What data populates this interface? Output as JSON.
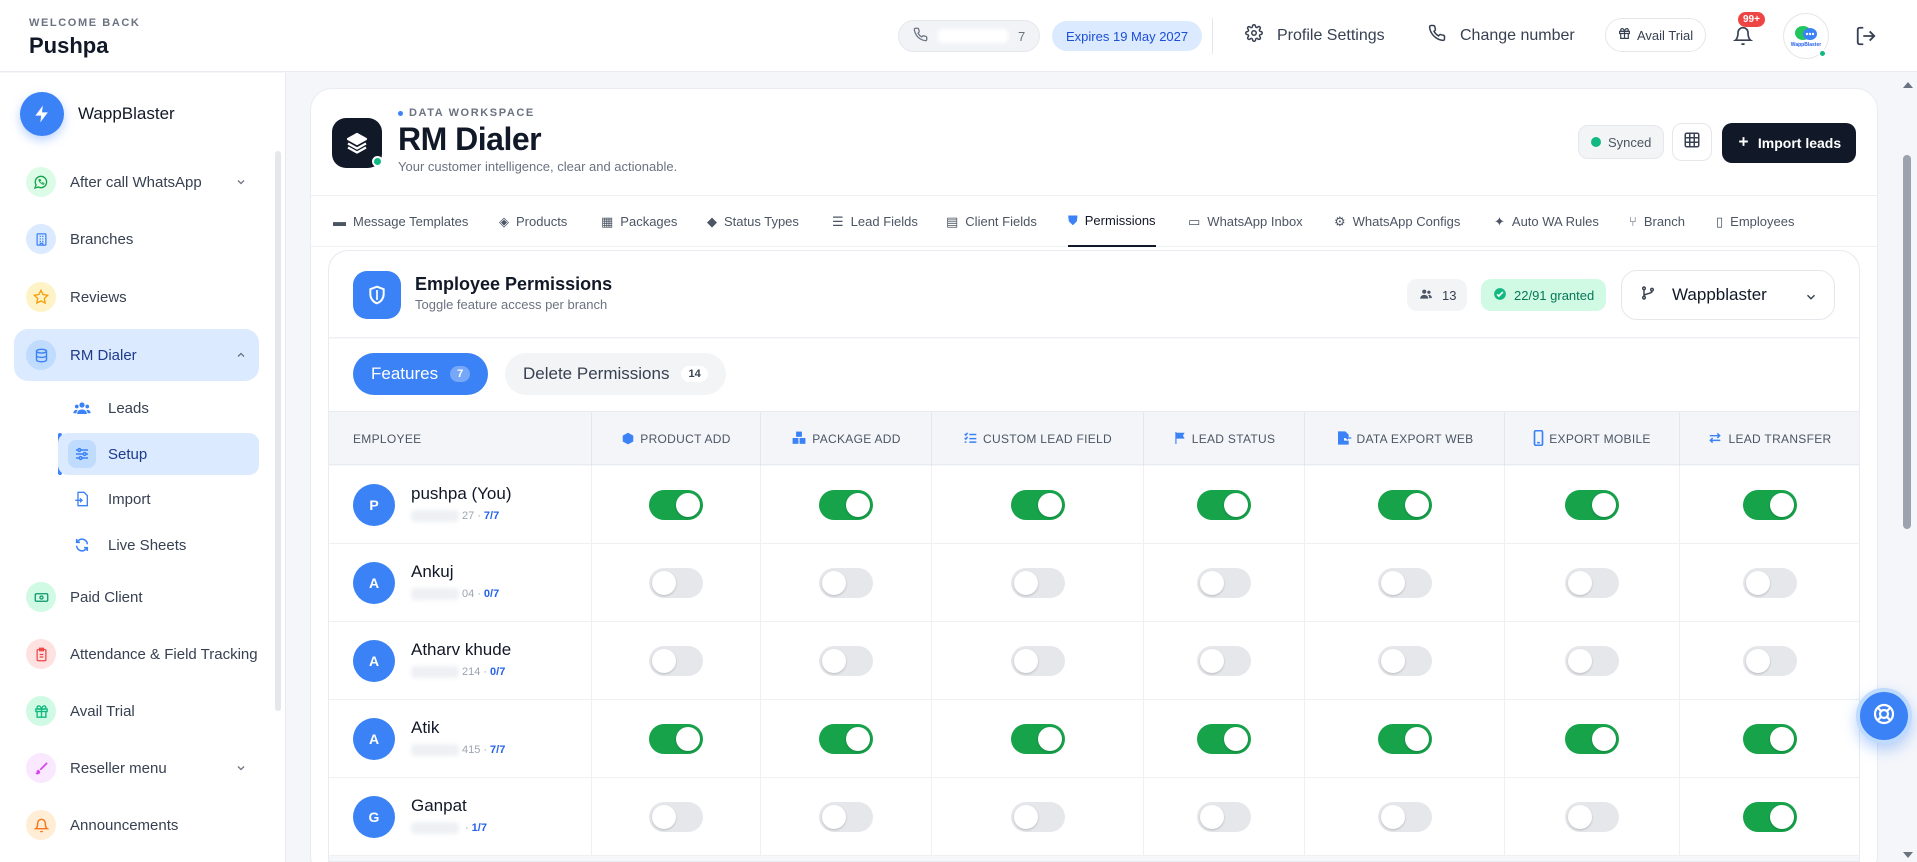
{
  "header": {
    "welcome_label": "WELCOME BACK",
    "username": "Pushpa",
    "phone_suffix": "7",
    "expires_label": "Expires 19 May 2027",
    "profile_settings_label": "Profile Settings",
    "change_number_label": "Change number",
    "avail_trial_label": "Avail Trial",
    "notification_badge": "99+",
    "avatar_text": "WappBlaster"
  },
  "sidebar": {
    "brand": "WappBlaster",
    "items": [
      {
        "label": "After call WhatsApp",
        "icon": "whatsapp-icon",
        "color": "#16a34a",
        "bg": "#dcfce7"
      },
      {
        "label": "Branches",
        "icon": "building-icon",
        "color": "#3b82f6",
        "bg": "#dbeafe"
      },
      {
        "label": "Reviews",
        "icon": "star-icon",
        "color": "#f59e0b",
        "bg": "#fef3c7"
      },
      {
        "label": "RM Dialer",
        "icon": "database-icon",
        "color": "#3b82f6",
        "bg": "#bfdbfe"
      },
      {
        "label": "Paid Client",
        "icon": "cash-icon",
        "color": "#059669",
        "bg": "#d1fae5"
      },
      {
        "label": "Attendance & Field Tracking",
        "icon": "clipboard-icon",
        "color": "#ef4444",
        "bg": "#fee2e2"
      },
      {
        "label": "Avail Trial",
        "icon": "gift-icon",
        "color": "#10b981",
        "bg": "#d1fae5"
      },
      {
        "label": "Reseller menu",
        "icon": "brush-icon",
        "color": "#d946ef",
        "bg": "#fae8ff"
      },
      {
        "label": "Announcements",
        "icon": "bell-icon",
        "color": "#f97316",
        "bg": "#ffedd5"
      }
    ],
    "subitems": [
      {
        "label": "Leads",
        "icon": "users-icon"
      },
      {
        "label": "Setup",
        "icon": "sliders-icon"
      },
      {
        "label": "Import",
        "icon": "file-import-icon"
      },
      {
        "label": "Live Sheets",
        "icon": "sync-icon"
      }
    ]
  },
  "workspace": {
    "label": "DATA WORKSPACE",
    "title": "RM Dialer",
    "subtitle": "Your customer intelligence, clear and actionable.",
    "synced_label": "Synced",
    "import_label": "Import leads"
  },
  "tabs": [
    {
      "label": "Message Templates",
      "icon": "message-icon"
    },
    {
      "label": "Products",
      "icon": "tag-icon"
    },
    {
      "label": "Packages",
      "icon": "boxes-icon"
    },
    {
      "label": "Status Types",
      "icon": "label-icon"
    },
    {
      "label": "Lead Fields",
      "icon": "list-icon"
    },
    {
      "label": "Client Fields",
      "icon": "table-icon"
    },
    {
      "label": "Permissions",
      "icon": "shield-icon"
    },
    {
      "label": "WhatsApp Inbox",
      "icon": "inbox-icon"
    },
    {
      "label": "WhatsApp Configs",
      "icon": "gear-icon"
    },
    {
      "label": "Auto WA Rules",
      "icon": "magic-icon"
    },
    {
      "label": "Branch",
      "icon": "branch-icon"
    },
    {
      "label": "Employees",
      "icon": "id-card-icon"
    }
  ],
  "permissions": {
    "title": "Employee Permissions",
    "subtitle": "Toggle feature access per branch",
    "employee_count": "13",
    "granted_label": "22/91 granted",
    "branch": "Wappblaster",
    "feature_tab": {
      "label": "Features",
      "count": "7"
    },
    "delete_tab": {
      "label": "Delete Permissions",
      "count": "14"
    },
    "columns": [
      {
        "label": "EMPLOYEE",
        "icon": ""
      },
      {
        "label": "PRODUCT ADD",
        "icon": "box-icon"
      },
      {
        "label": "PACKAGE ADD",
        "icon": "boxes-icon"
      },
      {
        "label": "CUSTOM LEAD FIELD",
        "icon": "list-check-icon"
      },
      {
        "label": "LEAD STATUS",
        "icon": "flag-icon"
      },
      {
        "label": "DATA EXPORT WEB",
        "icon": "file-export-icon"
      },
      {
        "label": "EXPORT MOBILE",
        "icon": "mobile-icon"
      },
      {
        "label": "LEAD TRANSFER",
        "icon": "transfer-icon"
      }
    ],
    "rows": [
      {
        "initial": "P",
        "name": "pushpa (You)",
        "phone_tail": "27",
        "score": "7/7",
        "perms": [
          true,
          true,
          true,
          true,
          true,
          true,
          true
        ]
      },
      {
        "initial": "A",
        "name": "Ankuj",
        "phone_tail": "04",
        "score": "0/7",
        "perms": [
          false,
          false,
          false,
          false,
          false,
          false,
          false
        ]
      },
      {
        "initial": "A",
        "name": "Atharv khude",
        "phone_tail": "214",
        "score": "0/7",
        "perms": [
          false,
          false,
          false,
          false,
          false,
          false,
          false
        ]
      },
      {
        "initial": "A",
        "name": "Atik",
        "phone_tail": "415",
        "score": "7/7",
        "perms": [
          true,
          true,
          true,
          true,
          true,
          true,
          true
        ]
      },
      {
        "initial": "G",
        "name": "Ganpat",
        "phone_tail": "",
        "score": "1/7",
        "perms": [
          false,
          false,
          false,
          false,
          false,
          false,
          true
        ]
      }
    ]
  }
}
